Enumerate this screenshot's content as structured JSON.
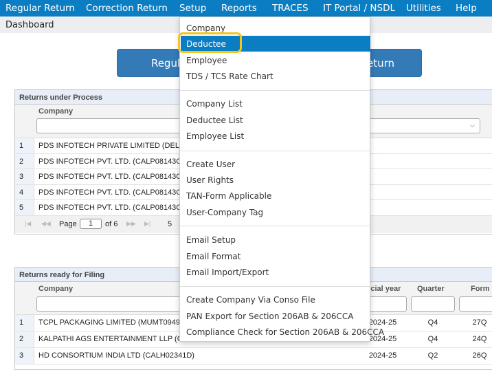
{
  "menu": [
    "Regular Return",
    "Correction Return",
    "Setup",
    "Reports",
    "TRACES",
    "IT Portal / NSDL",
    "Utilities",
    "Help"
  ],
  "breadcrumb": "Dashboard",
  "buttons": {
    "regular": "Regular Return",
    "correction": "Correction Return"
  },
  "panel1": {
    "title": "Returns under Process",
    "col_company": "Company",
    "rows": [
      {
        "n": "1",
        "company": "PDS INFOTECH PRIVATE LIMITED (DELS"
      },
      {
        "n": "2",
        "company": "PDS INFOTECH PVT. LTD. (CALP08143C)"
      },
      {
        "n": "3",
        "company": "PDS INFOTECH PVT. LTD. (CALP08143C)"
      },
      {
        "n": "4",
        "company": "PDS INFOTECH PVT. LTD. (CALP08143C)"
      },
      {
        "n": "5",
        "company": "PDS INFOTECH PVT. LTD. (CALP08143C)"
      }
    ],
    "pager": {
      "page_label": "Page",
      "page": "1",
      "of": "of 6",
      "page_size": "5"
    }
  },
  "panel2": {
    "title": "Returns ready for Filing",
    "col_company": "Company",
    "col_fy": "Financial year",
    "col_quarter": "Quarter",
    "col_form": "Form",
    "rows": [
      {
        "n": "1",
        "company": "TCPL PACKAGING LIMITED (MUMT09495",
        "fy": "2024-25",
        "q": "Q4",
        "form": "27Q"
      },
      {
        "n": "2",
        "company": "KALPATHI AGS ENTERTAINMENT LLP (CHEK",
        "fy": "2024-25",
        "q": "Q4",
        "form": "24Q"
      },
      {
        "n": "3",
        "company": "HD CONSORTIUM INDIA LTD (CALH02341D)",
        "fy": "2024-25",
        "q": "Q2",
        "form": "26Q"
      }
    ]
  },
  "setup_menu": {
    "groups": [
      [
        "Company",
        "Deductee",
        "Employee",
        "TDS / TCS Rate Chart"
      ],
      [
        "Company List",
        "Deductee List",
        "Employee List"
      ],
      [
        "Create User",
        "User Rights",
        "TAN-Form Applicable",
        "User-Company Tag"
      ],
      [
        "Email Setup",
        "Email Format",
        "Email Import/Export"
      ],
      [
        "Create Company Via Conso File",
        "PAN Export for Section 206AB & 206CCA",
        "Compliance Check for Section 206AB & 206CCA"
      ]
    ],
    "active": "Deductee"
  },
  "colors": {
    "accent": "#0b7ec3",
    "highlight": "#f5c518"
  }
}
